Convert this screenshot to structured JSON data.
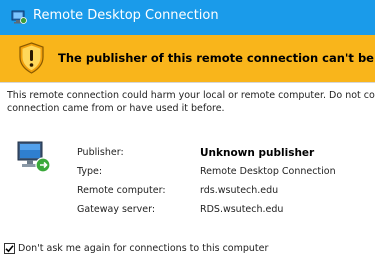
{
  "window": {
    "title": "Remote Desktop Connection"
  },
  "banner": {
    "text": "The publisher of this remote connection can't be identified."
  },
  "warning": {
    "line1": "This remote connection could harm your local or remote computer. Do not connect unless you know where this",
    "line2": "connection came from or have used it before."
  },
  "details": [
    {
      "label": "Publisher:",
      "value": "Unknown publisher"
    },
    {
      "label": "Type:",
      "value": "Remote Desktop Connection"
    },
    {
      "label": "Remote computer:",
      "value": "rds.wsutech.edu"
    },
    {
      "label": "Gateway server:",
      "value": "RDS.wsutech.edu"
    }
  ],
  "checkbox": {
    "label": "Don't ask me again for connections to this computer",
    "checked": true
  },
  "icons": {
    "app": "remote-desktop-icon",
    "banner": "warning-shield-icon",
    "computer": "remote-computer-icon",
    "check": "checkmark-icon"
  },
  "colors": {
    "titlebar": "#1a9bea",
    "banner": "#f9b51b"
  }
}
